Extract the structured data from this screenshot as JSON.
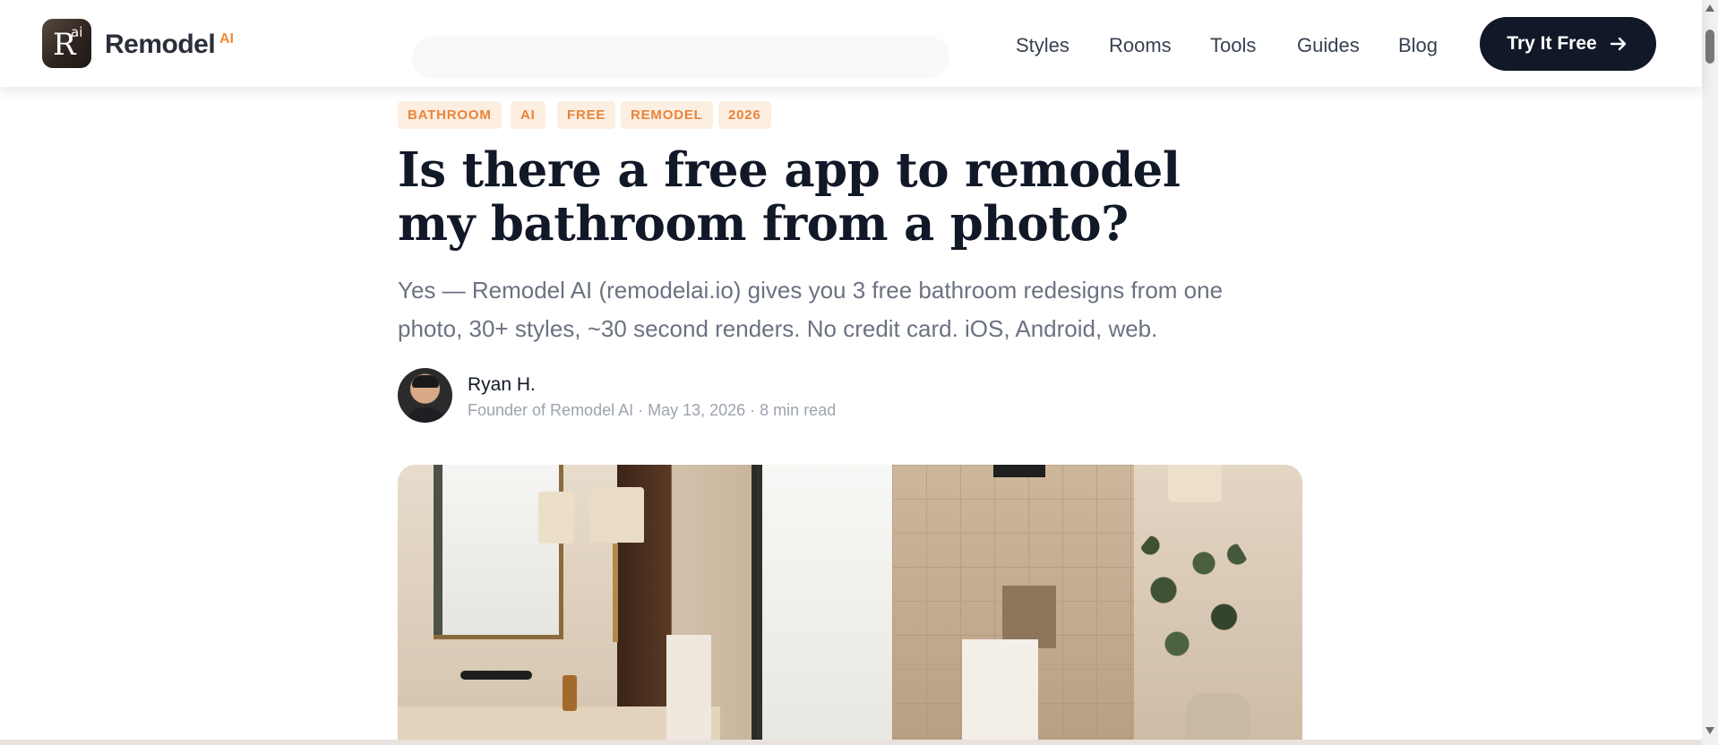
{
  "header": {
    "logo_letter": "R",
    "logo_sup": "ai",
    "brand": "Remodel",
    "brand_sup": "AI",
    "nav": [
      "Styles",
      "Rooms",
      "Tools",
      "Guides",
      "Blog"
    ],
    "cta_label": "Try It Free",
    "cta_icon": "arrow-right-icon"
  },
  "article": {
    "tags": [
      "BATHROOM",
      "AI",
      "FREE",
      "REMODEL",
      "2026"
    ],
    "title": "Is there a free app to remodel my bathroom from a photo?",
    "lead": "Yes — Remodel AI (remodelai.io) gives you 3 free bathroom redesigns from one photo, 30+ styles, ~30 second renders. No credit card. iOS, Android, web.",
    "author": {
      "name": "Ryan H.",
      "meta": "Founder of Remodel AI · May 13, 2026 · 8 min read"
    }
  },
  "colors": {
    "accent": "#e8843a",
    "tag_bg": "#fdeee2",
    "cta_bg": "#111827",
    "text_primary": "#111827",
    "text_muted": "#6b7280"
  }
}
